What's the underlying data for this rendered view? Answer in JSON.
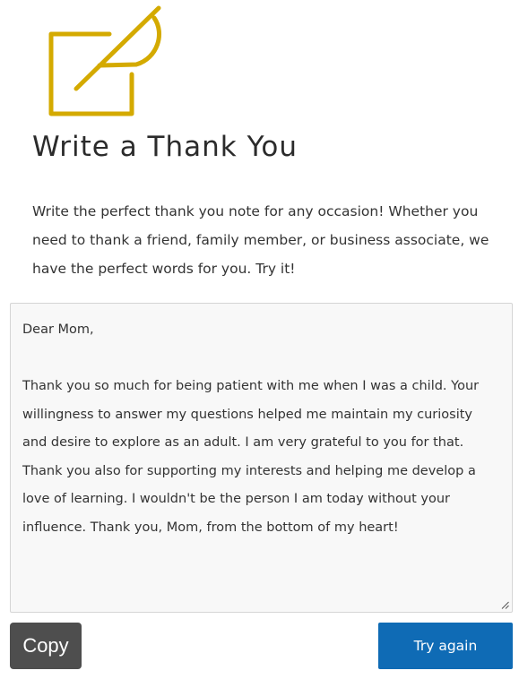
{
  "header": {
    "logo_icon": "pen-square-icon",
    "logo_color": "#d4aa00",
    "title": "Write a Thank You"
  },
  "intro": {
    "text": "Write the perfect thank you note for any occasion! Whether you need to thank a friend, family member, or business associate, we have the perfect words for you. Try it!"
  },
  "note": {
    "greeting": "Dear Mom,",
    "body": "Thank you so much for being patient with me when I was a child. Your willingness to answer my questions helped me maintain my curiosity and desire to explore as an adult. I am very grateful to you for that. Thank you also for supporting my interests and helping me develop a love of learning. I wouldn't be the person I am today without your influence. Thank you, Mom, from the bottom of my heart!"
  },
  "actions": {
    "copy_label": "Copy",
    "copy_color": "#4e4e4e",
    "try_again_label": "Try again",
    "try_again_color": "#0f6bb5"
  }
}
